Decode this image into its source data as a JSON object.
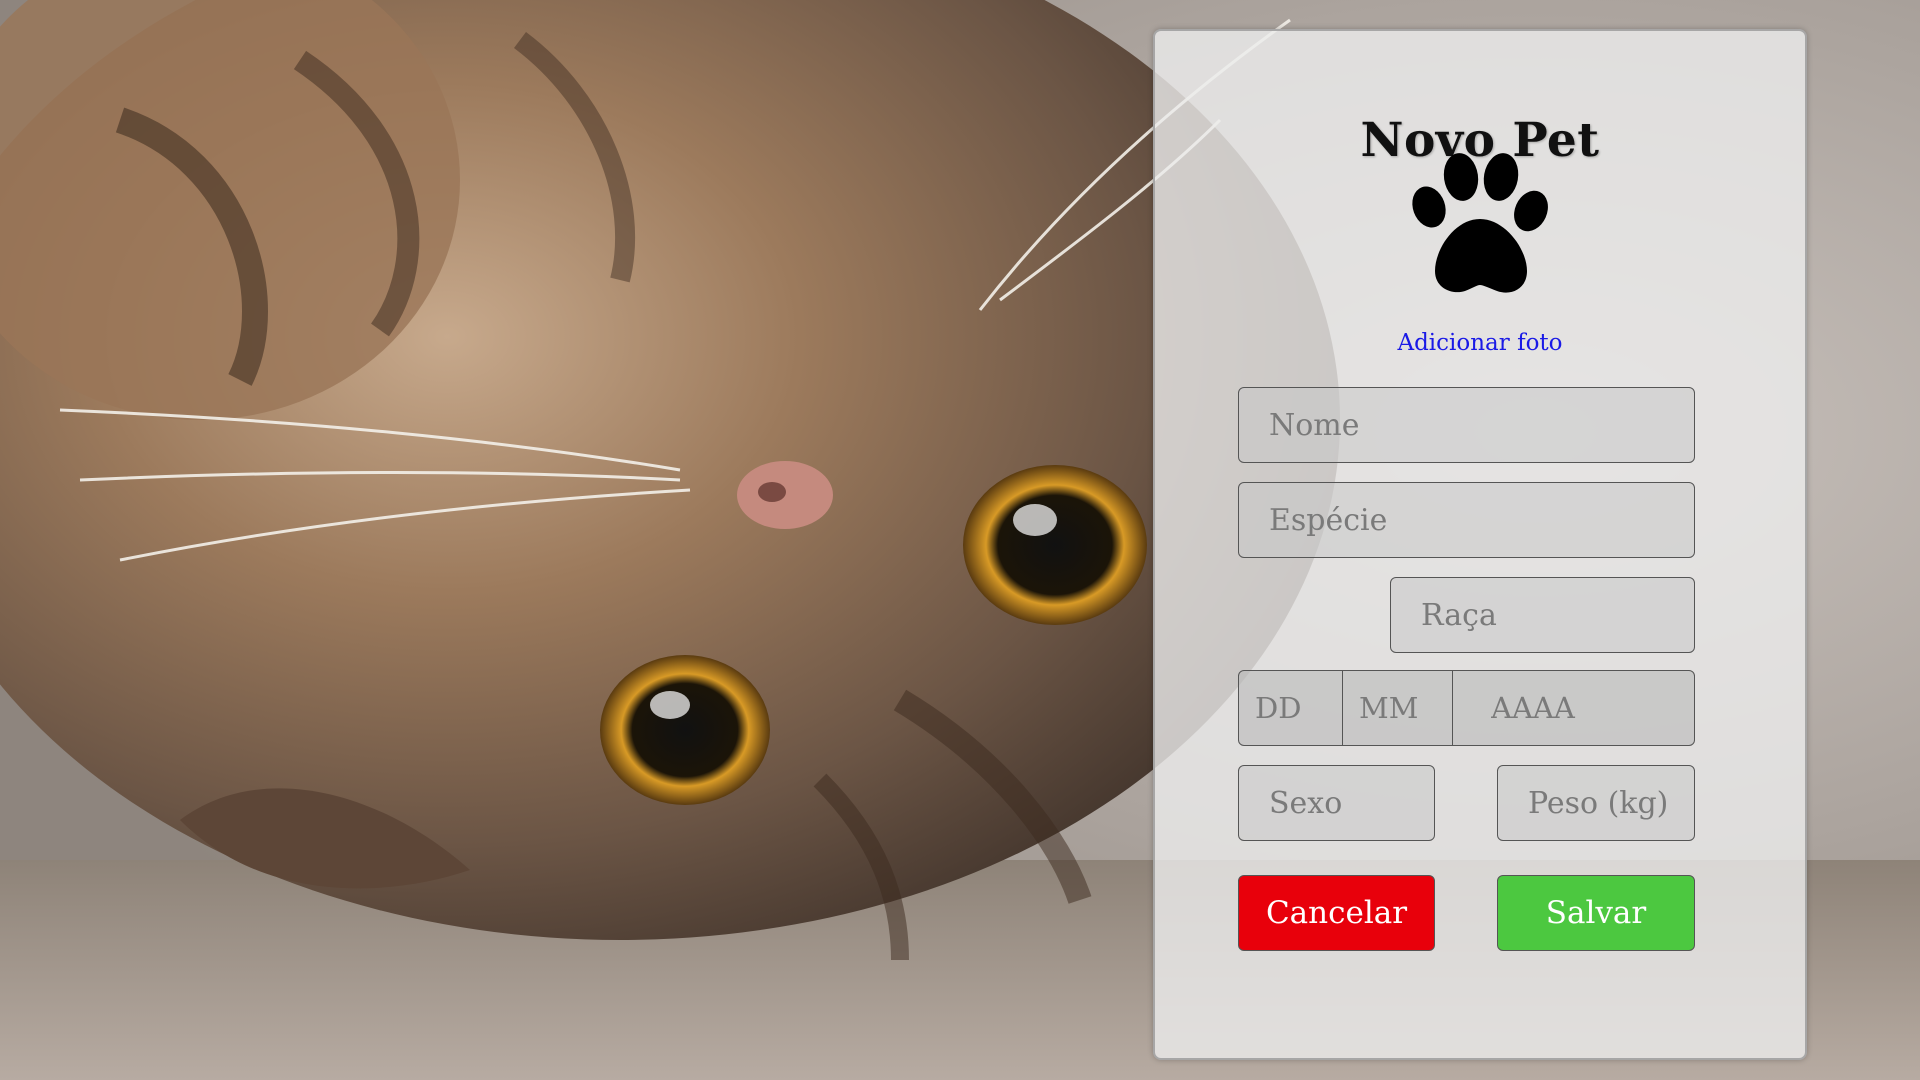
{
  "form": {
    "title": "Novo Pet",
    "add_photo_label": "Adicionar foto",
    "fields": {
      "nome_placeholder": "Nome",
      "especie_placeholder": "Espécie",
      "raca_placeholder": "Raça",
      "dia_placeholder": "DD",
      "mes_placeholder": "MM",
      "ano_placeholder": "AAAA",
      "sexo_placeholder": "Sexo",
      "peso_placeholder": "Peso (kg)"
    },
    "buttons": {
      "cancel_label": "Cancelar",
      "save_label": "Salvar"
    }
  },
  "colors": {
    "cancel": "#e8000b",
    "save": "#4cc840",
    "link": "#1a1ae6"
  },
  "icons": {
    "photo_placeholder": "paw-icon"
  }
}
